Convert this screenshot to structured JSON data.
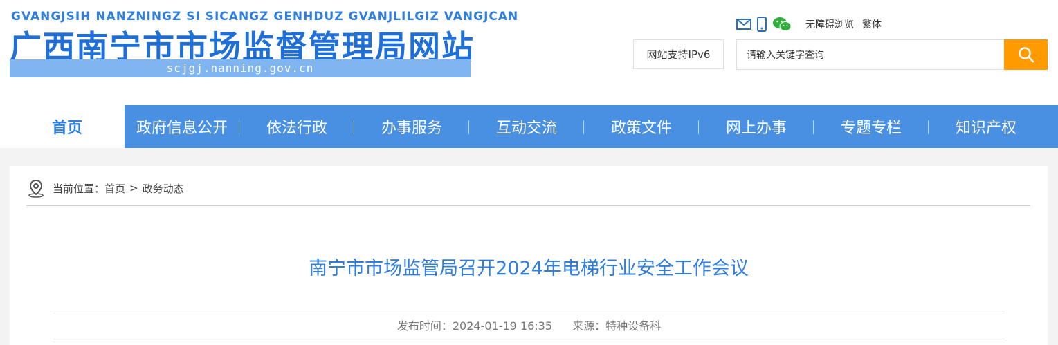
{
  "header": {
    "logo_pinyin": "GVANGJSIH NANZNINGZ SI SICANGZ GENHDUZ GVANJLILGIZ VANGJCAN",
    "logo_title": "广西南宁市市场监督管理局网站",
    "logo_domain": "scjgj.nanning.gov.cn",
    "tools": {
      "icons": [
        "mail-icon",
        "mobile-icon",
        "wechat-icon"
      ],
      "accessible_label": "无障碍浏览",
      "traditional_label": "繁体"
    },
    "ipv6_label": "网站支持IPv6",
    "search": {
      "placeholder": "请输入关键字查询",
      "button_icon": "search-icon"
    }
  },
  "nav": {
    "items": [
      {
        "label": "首页"
      },
      {
        "label": "政府信息公开"
      },
      {
        "label": "依法行政"
      },
      {
        "label": "办事服务"
      },
      {
        "label": "互动交流"
      },
      {
        "label": "政策文件"
      },
      {
        "label": "网上办事"
      },
      {
        "label": "专题专栏"
      },
      {
        "label": "知识产权"
      }
    ]
  },
  "breadcrumb": {
    "prefix": "当前位置：",
    "home": "首页",
    "separator": ">",
    "current": "政务动态"
  },
  "article": {
    "title": "南宁市市场监管局召开2024年电梯行业安全工作会议",
    "publish_label": "发布时间：2024-01-19 16:35",
    "source_label": "来源：特种设备科"
  },
  "colors": {
    "brand_blue": "#4a90e2",
    "title_blue": "#2f7fe0",
    "search_orange": "#ff9b00"
  }
}
